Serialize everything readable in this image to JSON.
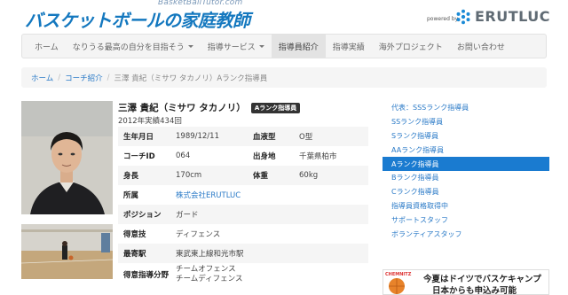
{
  "header": {
    "logo_sub": "BasketBallTutor.com",
    "logo_main": "バスケットボールの家庭教師",
    "powered_by": "powered by",
    "brand": "ERUTLUC"
  },
  "nav": {
    "items": [
      {
        "label": "ホーム",
        "dropdown": false,
        "active": false
      },
      {
        "label": "なりうる最高の自分を目指そう",
        "dropdown": true,
        "active": false
      },
      {
        "label": "指導サービス",
        "dropdown": true,
        "active": false
      },
      {
        "label": "指導員紹介",
        "dropdown": false,
        "active": true
      },
      {
        "label": "指導実績",
        "dropdown": false,
        "active": false
      },
      {
        "label": "海外プロジェクト",
        "dropdown": false,
        "active": false
      },
      {
        "label": "お問い合わせ",
        "dropdown": false,
        "active": false
      }
    ]
  },
  "breadcrumb": {
    "home": "ホーム",
    "coach": "コーチ紹介",
    "current": "三澤 貴紀（ミサワ タカノリ）Aランク指導員",
    "separator": "/"
  },
  "profile": {
    "name": "三澤 貴紀（ミサワ タカノリ）",
    "rank_badge": "Aランク指導員",
    "subline": "2012年実績434回",
    "rows": [
      {
        "l1": "生年月日",
        "v1": "1989/12/11",
        "l2": "血液型",
        "v2": "O型"
      },
      {
        "l1": "コーチID",
        "v1": "064",
        "l2": "出身地",
        "v2": "千葉県柏市"
      },
      {
        "l1": "身長",
        "v1": "170cm",
        "l2": "体重",
        "v2": "60kg"
      }
    ],
    "affiliation_label": "所属",
    "affiliation_value": "株式会社ERUTLUC",
    "position_label": "ポジション",
    "position_value": "ガード",
    "skill_label": "得意技",
    "skill_value": "ディフェンス",
    "station_label": "最寄駅",
    "station_value": "東武東上線和光市駅",
    "field_label": "得意指導分野",
    "field_line1": "チームオフェンス",
    "field_line2": "チームディフェンス"
  },
  "sidebar": {
    "items": [
      {
        "label": "代表：SSSランク指導員",
        "active": false
      },
      {
        "label": "SSランク指導員",
        "active": false
      },
      {
        "label": "Sランク指導員",
        "active": false
      },
      {
        "label": "AAランク指導員",
        "active": false
      },
      {
        "label": "Aランク指導員",
        "active": true
      },
      {
        "label": "Bランク指導員",
        "active": false
      },
      {
        "label": "Cランク指導員",
        "active": false
      },
      {
        "label": "指導員資格取得中",
        "active": false
      },
      {
        "label": "サポートスタッフ",
        "active": false
      },
      {
        "label": "ボランティアスタッフ",
        "active": false
      }
    ]
  },
  "banner": {
    "logo_text": "CHEMNITZ",
    "line1": "今夏はドイツでバスケキャンプ",
    "line2": "日本からも申込み可能"
  },
  "colors": {
    "accent": "#1a7bd0",
    "link": "#2a7ac7",
    "logo": "#1478bf"
  }
}
